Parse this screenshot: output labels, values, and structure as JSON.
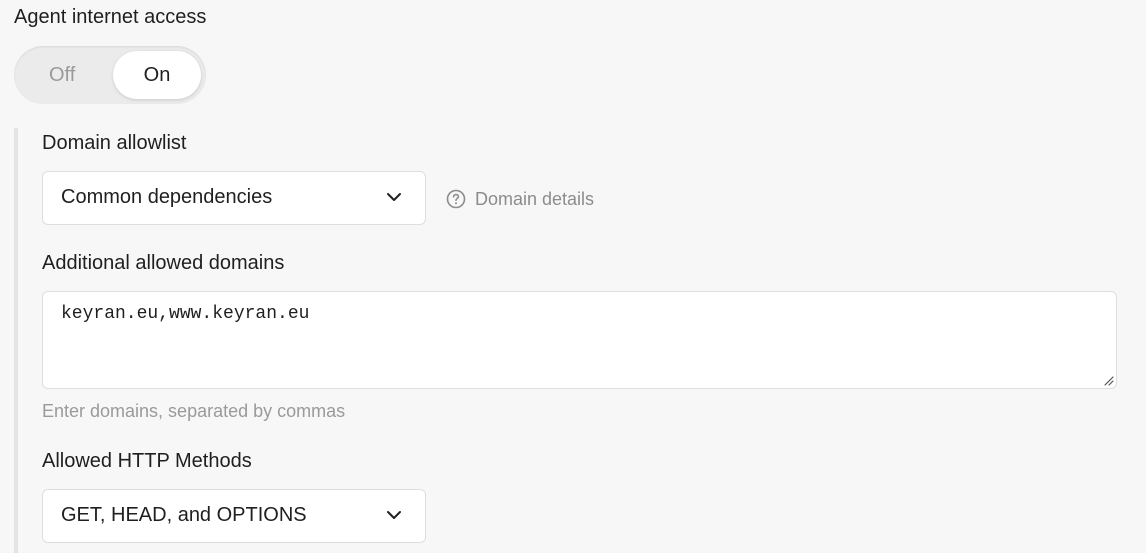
{
  "internet_access": {
    "title": "Agent internet access",
    "options": {
      "off": "Off",
      "on": "On"
    },
    "selected": "On"
  },
  "domain_allowlist": {
    "label": "Domain allowlist",
    "selected_value": "Common dependencies",
    "details_link": "Domain details"
  },
  "additional_domains": {
    "label": "Additional allowed domains",
    "value": "keyran.eu,www.keyran.eu",
    "hint": "Enter domains, separated by commas"
  },
  "http_methods": {
    "label": "Allowed HTTP Methods",
    "selected_value": "GET, HEAD, and OPTIONS"
  },
  "icons": {
    "dropdown": "chevron-down-icon",
    "help": "question-circle-icon",
    "resize": "resize-grip-icon"
  },
  "colors": {
    "background": "#f7f7f7",
    "text": "#1f1f1f",
    "muted_text": "#9a9a9a",
    "toggle_track": "#ebebeb",
    "toggle_active": "#ffffff",
    "border": "#dedede"
  }
}
